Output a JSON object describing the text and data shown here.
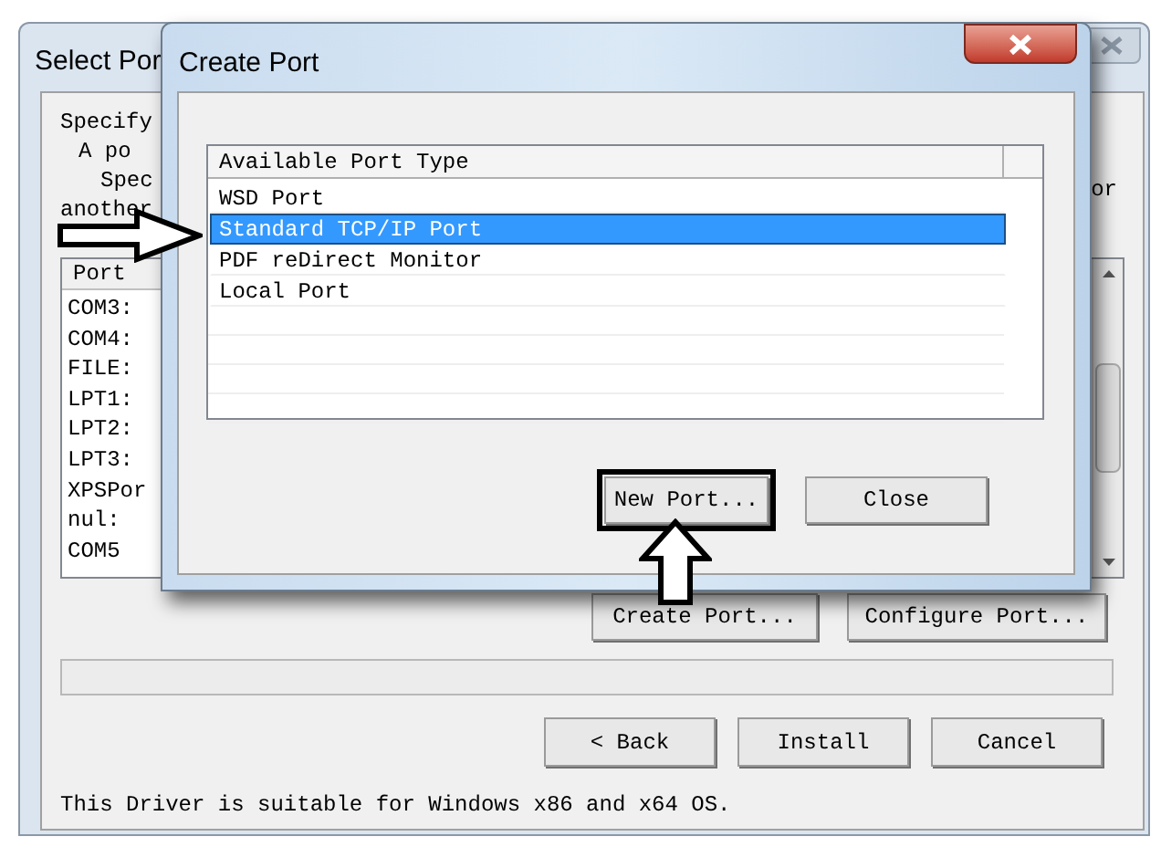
{
  "back_dialog": {
    "title": "Select Por",
    "intro_lines": [
      "Specify",
      "A po",
      "Spec",
      "another"
    ],
    "intro_right": "or",
    "port_list": {
      "header": "Port",
      "rows": [
        "COM3:",
        "COM4:",
        "FILE:",
        "LPT1:",
        "LPT2:",
        "LPT3:",
        "XPSPor",
        "nul:",
        "COM5"
      ]
    },
    "port_buttons": [
      "Create Port...",
      "Configure Port..."
    ],
    "progress": {
      "level": 0
    },
    "nav_buttons": [
      "< Back",
      "Install",
      "Cancel"
    ],
    "footer": "This Driver is suitable for Windows x86 and x64 OS."
  },
  "create_port_dialog": {
    "title": "Create Port",
    "list": {
      "header": "Available Port Type",
      "items": [
        {
          "label": "WSD Port",
          "selected": false
        },
        {
          "label": "Standard TCP/IP Port",
          "selected": true
        },
        {
          "label": "PDF reDirect Monitor",
          "selected": false
        },
        {
          "label": "Local Port",
          "selected": false
        }
      ]
    },
    "buttons": [
      {
        "label": "New Port...",
        "highlighted": true
      },
      {
        "label": "Close",
        "highlighted": false
      }
    ]
  }
}
